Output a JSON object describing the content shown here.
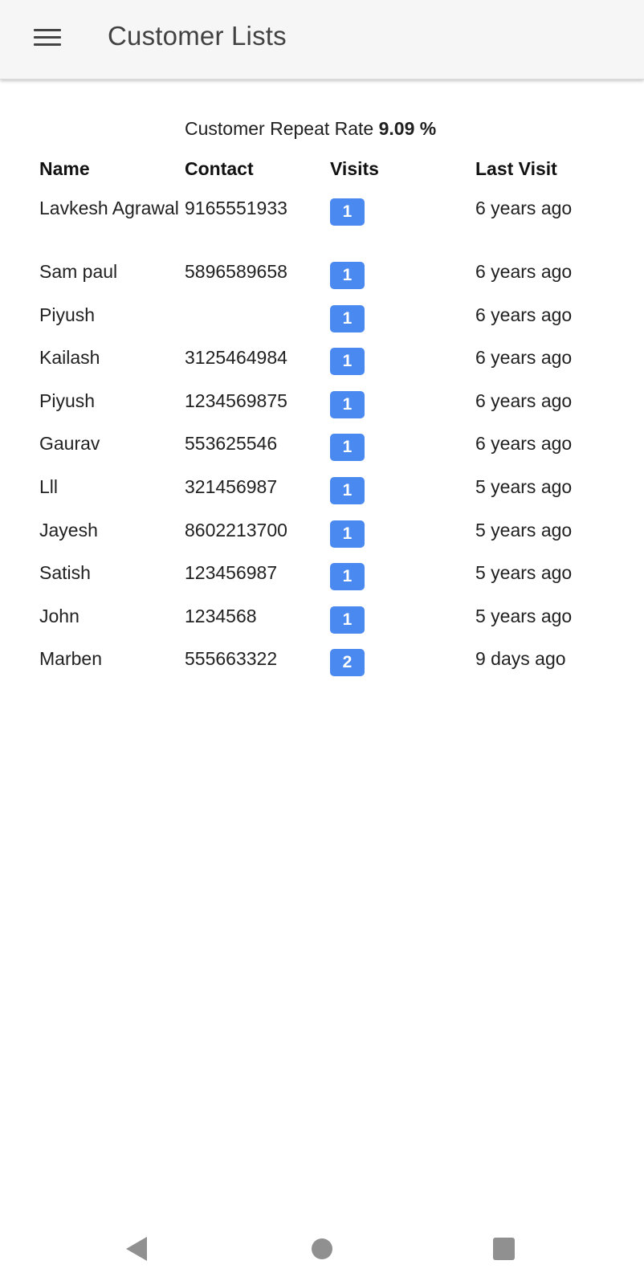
{
  "appbar": {
    "menu_icon": "hamburger-menu-icon",
    "title": "Customer Lists"
  },
  "summary": {
    "label": "Customer Repeat Rate",
    "value": "9.09 %"
  },
  "table": {
    "headers": [
      "Name",
      "Contact",
      "Visits",
      "Last Visit"
    ],
    "rows": [
      {
        "name": "Lavkesh Agrawal",
        "contact": "9165551933",
        "visits": "1",
        "last_visit": "6 years ago"
      },
      {
        "name": "Sam paul",
        "contact": "5896589658",
        "visits": "1",
        "last_visit": "6 years ago"
      },
      {
        "name": "Piyush",
        "contact": "",
        "visits": "1",
        "last_visit": "6 years ago"
      },
      {
        "name": "Kailash",
        "contact": "3125464984",
        "visits": "1",
        "last_visit": "6 years ago"
      },
      {
        "name": "Piyush",
        "contact": "1234569875",
        "visits": "1",
        "last_visit": "6 years ago"
      },
      {
        "name": "Gaurav",
        "contact": "553625546",
        "visits": "1",
        "last_visit": "6 years ago"
      },
      {
        "name": "Lll",
        "contact": "321456987",
        "visits": "1",
        "last_visit": "5 years ago"
      },
      {
        "name": "Jayesh",
        "contact": "8602213700",
        "visits": "1",
        "last_visit": "5 years ago"
      },
      {
        "name": "Satish",
        "contact": "123456987",
        "visits": "1",
        "last_visit": "5 years ago"
      },
      {
        "name": "John",
        "contact": "1234568",
        "visits": "1",
        "last_visit": "5 years ago"
      },
      {
        "name": "Marben",
        "contact": "555663322",
        "visits": "2",
        "last_visit": "9 days ago"
      }
    ]
  },
  "colors": {
    "badge": "#4a89f0",
    "appbar": "#f6f6f6"
  },
  "navbar": {
    "back_icon": "back-triangle-icon",
    "home_icon": "home-circle-icon",
    "recents_icon": "recents-square-icon"
  }
}
